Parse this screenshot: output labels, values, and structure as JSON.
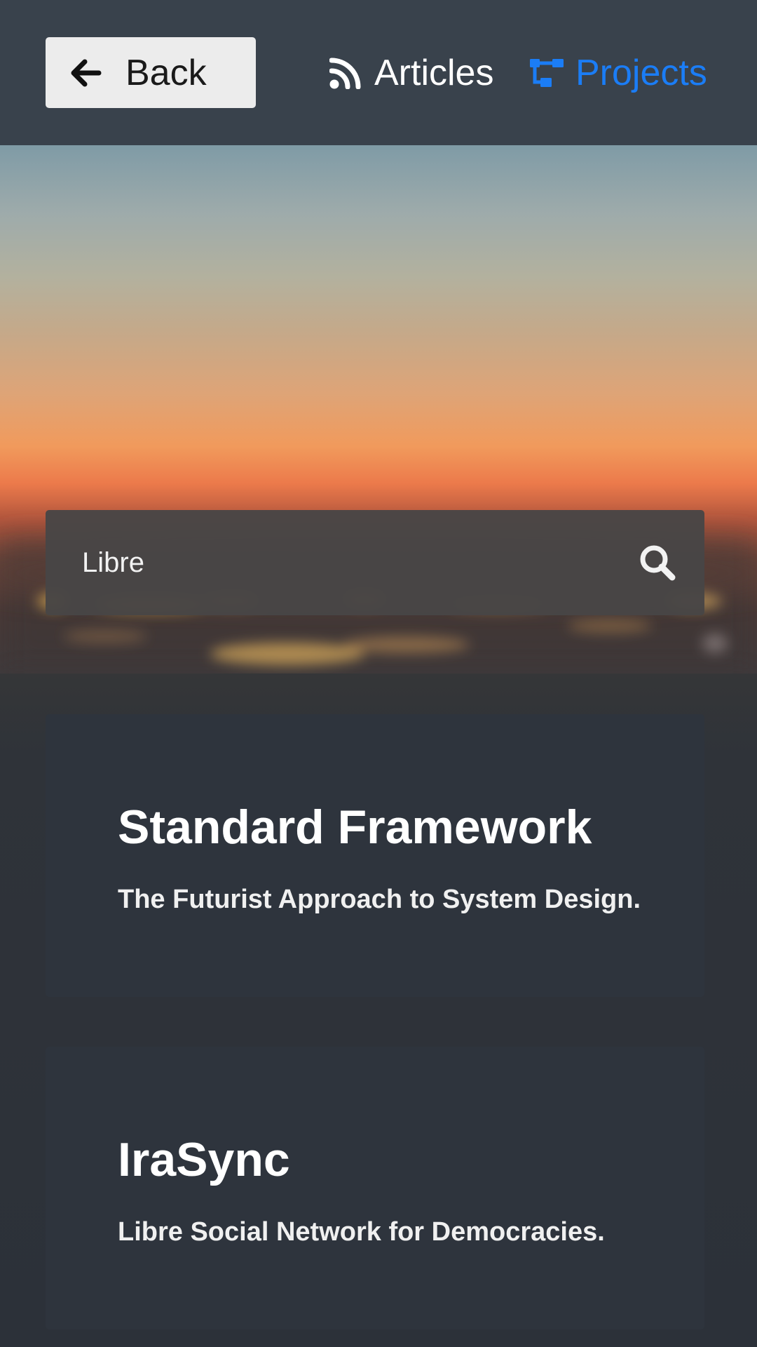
{
  "nav": {
    "back_label": "Back",
    "back_icon": "arrow-left-icon",
    "links": [
      {
        "label": "Articles",
        "icon": "rss-icon",
        "active": false,
        "color": "#ffffff"
      },
      {
        "label": "Projects",
        "icon": "sitemap-icon",
        "active": true,
        "color": "#1b7df6"
      }
    ]
  },
  "search": {
    "value": "Libre",
    "icon": "search-icon"
  },
  "results": [
    {
      "title": "Standard Framework",
      "subtitle": "The Futurist Approach to System Design."
    },
    {
      "title": "IraSync",
      "subtitle": "Libre Social Network for Democracies."
    }
  ],
  "colors": {
    "topbar": "#39424c",
    "accent": "#1b7df6",
    "card_background": "#2e343d",
    "search_background": "#484646"
  }
}
